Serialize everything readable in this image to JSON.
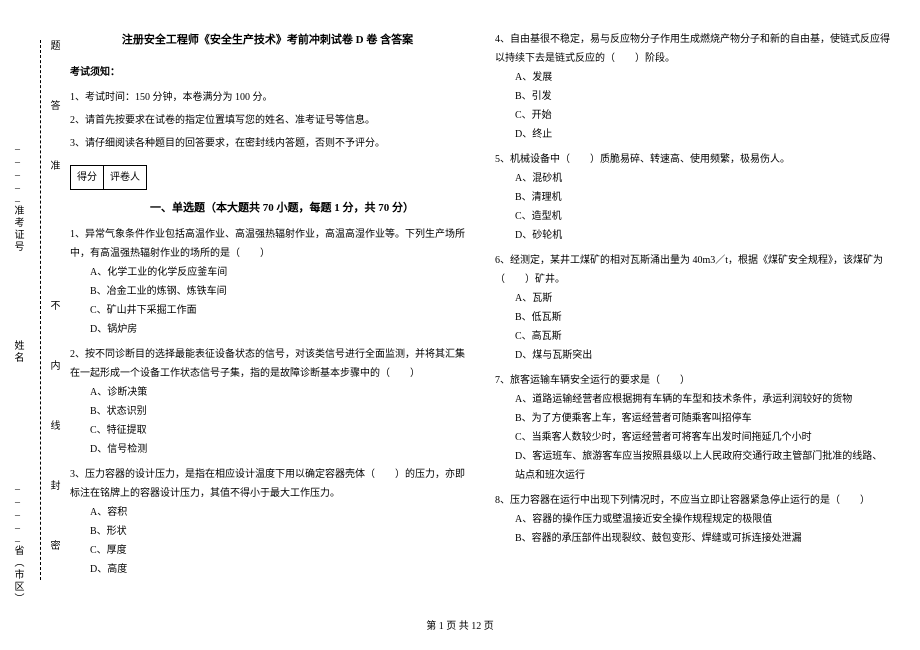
{
  "side": {
    "labels": [
      "_____省（市区）",
      "姓名",
      "_____准考证号",
      "密",
      "封",
      "线",
      "内",
      "不",
      "答",
      "准",
      "题"
    ]
  },
  "header": {
    "title": "注册安全工程师《安全生产技术》考前冲刺试卷 D 卷 含答案",
    "notice_label": "考试须知：",
    "notice1": "1、考试时间：150 分钟，本卷满分为 100 分。",
    "notice2": "2、请首先按要求在试卷的指定位置填写您的姓名、准考证号等信息。",
    "notice3": "3、请仔细阅读各种题目的回答要求，在密封线内答题，否则不予评分。",
    "score_cells": [
      "得分",
      "评卷人"
    ],
    "section1": "一、单选题（本大题共 70 小题，每题 1 分，共 70 分）"
  },
  "q1": {
    "stem": "1、异常气象条件作业包括高温作业、高温强热辐射作业，高温高湿作业等。下列生产场所中，有高温强热辐射作业的场所的是（　　）",
    "a": "A、化学工业的化学反应釜车间",
    "b": "B、冶金工业的炼钢、炼铁车间",
    "c": "C、矿山井下采掘工作面",
    "d": "D、锅炉房"
  },
  "q2": {
    "stem": "2、按不同诊断目的选择最能表征设备状态的信号，对该类信号进行全面监测，并将其汇集在一起形成一个设备工作状态信号子集，指的是故障诊断基本步骤中的（　　）",
    "a": "A、诊断决策",
    "b": "B、状态识别",
    "c": "C、特征提取",
    "d": "D、信号检测"
  },
  "q3": {
    "stem": "3、压力容器的设计压力，是指在相应设计温度下用以确定容器壳体（　　）的压力，亦即标注在铭牌上的容器设计压力，其值不得小于最大工作压力。",
    "a": "A、容积",
    "b": "B、形状",
    "c": "C、厚度",
    "d": "D、高度"
  },
  "q4": {
    "stem": "4、自由基很不稳定，易与反应物分子作用生成燃烧产物分子和新的自由基，使链式反应得以持续下去是链式反应的（　　）阶段。",
    "a": "A、发展",
    "b": "B、引发",
    "c": "C、开始",
    "d": "D、终止"
  },
  "q5": {
    "stem": "5、机械设备中（　　）质脆易碎、转速高、使用频繁，极易伤人。",
    "a": "A、混砂机",
    "b": "B、清理机",
    "c": "C、造型机",
    "d": "D、砂轮机"
  },
  "q6": {
    "stem": "6、经测定，某井工煤矿的相对瓦斯涌出量为 40m3／t，根据《煤矿安全规程》，该煤矿为（　　）矿井。",
    "a": "A、瓦斯",
    "b": "B、低瓦斯",
    "c": "C、高瓦斯",
    "d": "D、煤与瓦斯突出"
  },
  "q7": {
    "stem": "7、旅客运输车辆安全运行的要求是（　　）",
    "a": "A、道路运输经营者应根据拥有车辆的车型和技术条件，承运利润较好的货物",
    "b": "B、为了方便乘客上车，客运经营者可随乘客叫招停车",
    "c": "C、当乘客人数较少时，客运经营者可将客车出发时间拖延几个小时",
    "d": "D、客运班车、旅游客车应当按照县级以上人民政府交通行政主管部门批准的线路、站点和班次运行"
  },
  "q8": {
    "stem": "8、压力容器在运行中出现下列情况时，不应当立即让容器紧急停止运行的是（　　）",
    "a": "A、容器的操作压力或壁温接近安全操作规程规定的极限值",
    "b": "B、容器的承压部件出现裂纹、鼓包变形、焊缝或可拆连接处泄漏"
  },
  "footer": "第 1 页 共 12 页"
}
